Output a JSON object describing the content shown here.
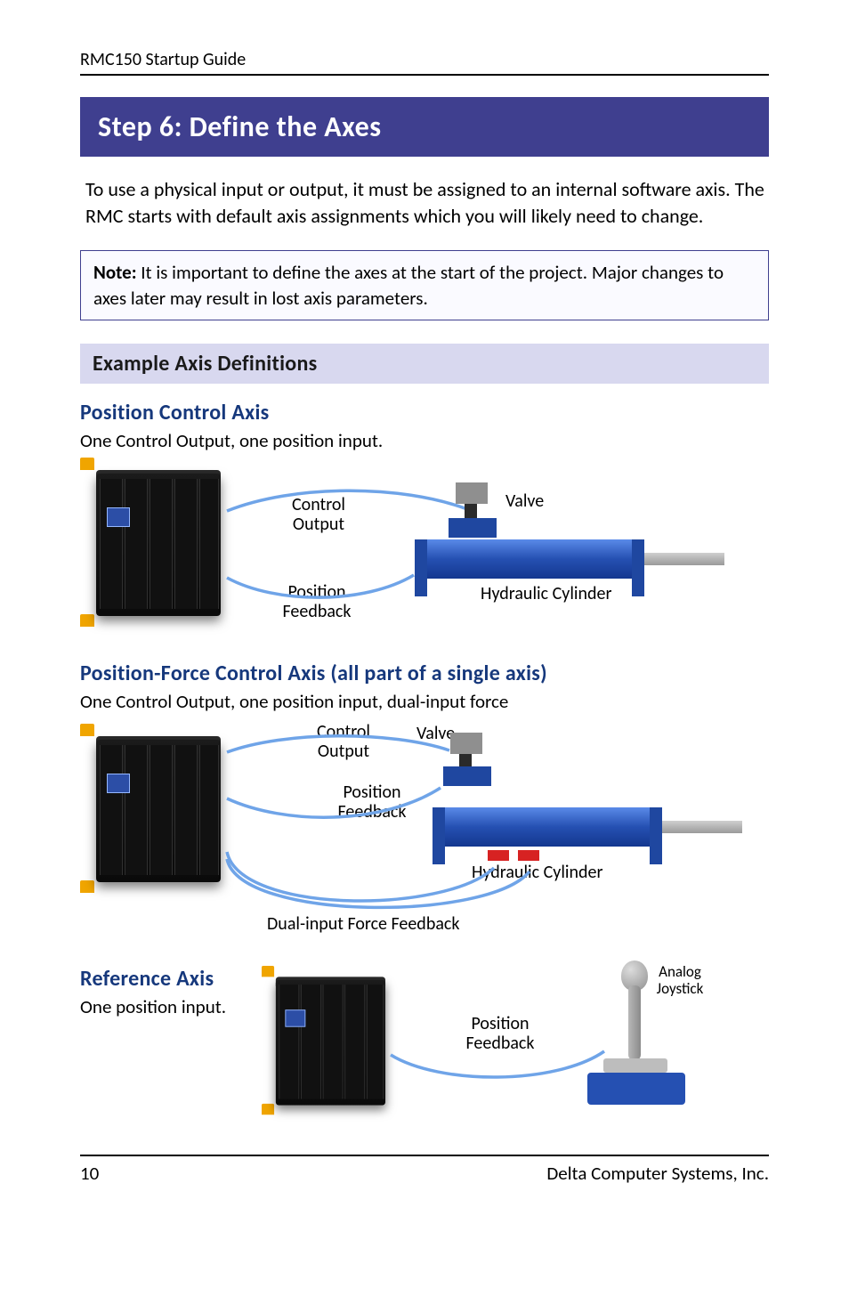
{
  "header": {
    "running_head": "RMC150 Startup Guide"
  },
  "banner": {
    "title": "Step 6: Define the Axes"
  },
  "intro": "To use a physical input or output, it must be assigned to an internal software axis. The RMC starts with default axis assignments which you will likely need to change.",
  "note": {
    "label": "Note:",
    "text": "It is important to define the axes at the start of the project. Major changes to axes later may result in lost axis parameters."
  },
  "example_heading": "Example Axis Definitions",
  "sections": {
    "position": {
      "title": "Position Control Axis",
      "desc": "One Control Output, one position input.",
      "labels": {
        "control_output": "Control Output",
        "valve": "Valve",
        "position_feedback": "Position Feedback",
        "hydraulic_cylinder": "Hydraulic Cylinder"
      }
    },
    "position_force": {
      "title": "Position-Force Control Axis (all part of a single axis)",
      "desc": "One Control Output, one position input, dual-input force",
      "labels": {
        "control_output": "Control Output",
        "valve": "Valve",
        "position_feedback": "Position Feedback",
        "hydraulic_cylinder": "Hydraulic Cylinder",
        "dual_force": "Dual-input Force Feedback"
      }
    },
    "reference": {
      "title": "Reference Axis",
      "desc": "One position input.",
      "labels": {
        "position_feedback": "Position Feedback",
        "joystick": "Analog Joystick"
      }
    }
  },
  "footer": {
    "page": "10",
    "company": "Delta Computer Systems, Inc."
  },
  "colors": {
    "banner": "#3f3f8f",
    "subbanner": "#d8d8ef",
    "heading": "#16387c"
  }
}
